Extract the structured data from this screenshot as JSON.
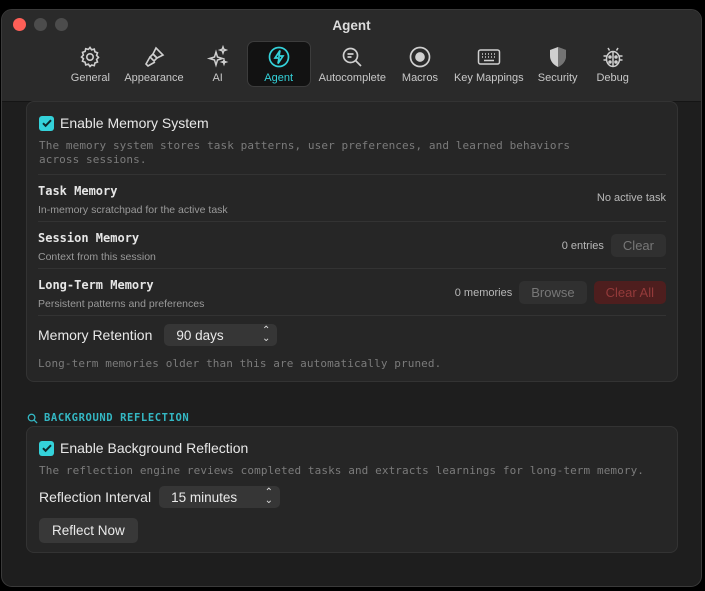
{
  "window": {
    "title": "Agent"
  },
  "toolbar": {
    "tabs": [
      {
        "label": "General",
        "icon": "gear-icon"
      },
      {
        "label": "Appearance",
        "icon": "paintbrush-icon"
      },
      {
        "label": "AI",
        "icon": "sparkles-icon"
      },
      {
        "label": "Agent",
        "icon": "bolt-icon",
        "active": true
      },
      {
        "label": "Autocomplete",
        "icon": "magnifier-icon"
      },
      {
        "label": "Macros",
        "icon": "record-icon"
      },
      {
        "label": "Key Mappings",
        "icon": "keyboard-icon"
      },
      {
        "label": "Security",
        "icon": "shield-icon"
      },
      {
        "label": "Debug",
        "icon": "ladybug-icon"
      }
    ]
  },
  "memory": {
    "enable_label": "Enable Memory System",
    "enabled": true,
    "description": "The memory system stores task patterns, user preferences, and learned behaviors across sessions.",
    "task": {
      "title": "Task Memory",
      "subtitle": "In-memory scratchpad for the active task",
      "status": "No active task"
    },
    "session": {
      "title": "Session Memory",
      "subtitle": "Context from this session",
      "count": "0 entries",
      "clear_label": "Clear"
    },
    "longterm": {
      "title": "Long-Term Memory",
      "subtitle": "Persistent patterns and preferences",
      "count": "0 memories",
      "browse_label": "Browse",
      "clear_all_label": "Clear All"
    },
    "retention": {
      "label": "Memory Retention",
      "value": "90 days",
      "note": "Long-term memories older than this are automatically pruned."
    }
  },
  "reflection": {
    "section_title": "BACKGROUND REFLECTION",
    "enable_label": "Enable Background Reflection",
    "enabled": true,
    "description": "The reflection engine reviews completed tasks and extracts learnings for long-term memory.",
    "interval": {
      "label": "Reflection Interval",
      "value": "15 minutes"
    },
    "reflect_now_label": "Reflect Now"
  },
  "colors": {
    "accent": "#34d2da",
    "danger_bg": "#4e1e1e",
    "danger_text": "#943a3a",
    "close": "#fe5f57"
  }
}
